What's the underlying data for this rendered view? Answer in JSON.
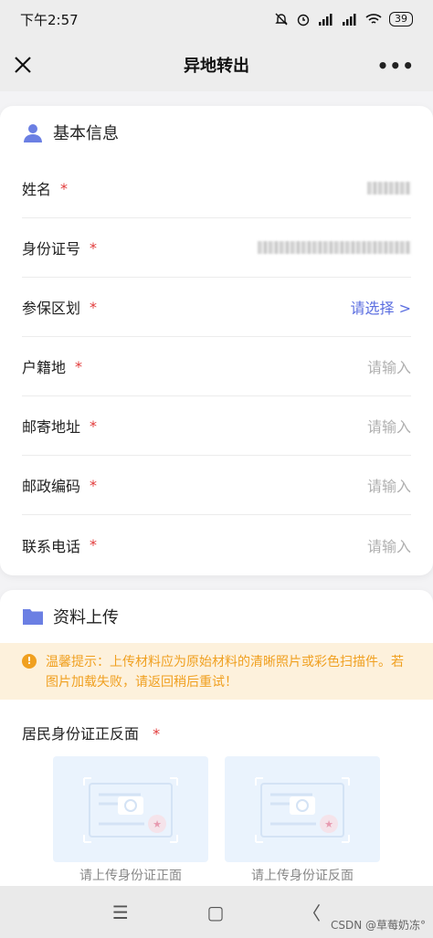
{
  "status_bar": {
    "time": "下午2:57",
    "battery": "39"
  },
  "header": {
    "title": "异地转出"
  },
  "basic_info": {
    "title": "基本信息",
    "fields": [
      {
        "label": "姓名",
        "required": "*",
        "value": ""
      },
      {
        "label": "身份证号",
        "required": "*",
        "value": ""
      },
      {
        "label": "参保区划",
        "required": "*",
        "value": "请选择 >"
      },
      {
        "label": "户籍地",
        "required": "*",
        "value": "请输入"
      },
      {
        "label": "邮寄地址",
        "required": "*",
        "value": "请输入"
      },
      {
        "label": "邮政编码",
        "required": "*",
        "value": "请输入"
      },
      {
        "label": "联系电话",
        "required": "*",
        "value": "请输入"
      }
    ]
  },
  "upload": {
    "title": "资料上传",
    "notice_line1": "温馨提示：上传材料应为原始材料的清晰照片或彩色扫描件。若",
    "notice_line2": "图片加载失败，请返回稍后重试！",
    "id_label": "居民身份证正反面",
    "required": "*",
    "front_caption": "请上传身份证正面",
    "back_caption": "请上传身份证反面"
  },
  "nav_bar": {
    "menu": "☰",
    "home": "▢",
    "back": "〈"
  },
  "watermark": "CSDN @草莓奶冻°",
  "colors": {
    "accent": "#5b6ee0",
    "required": "#e23b3b",
    "notice": "#f0a020"
  }
}
